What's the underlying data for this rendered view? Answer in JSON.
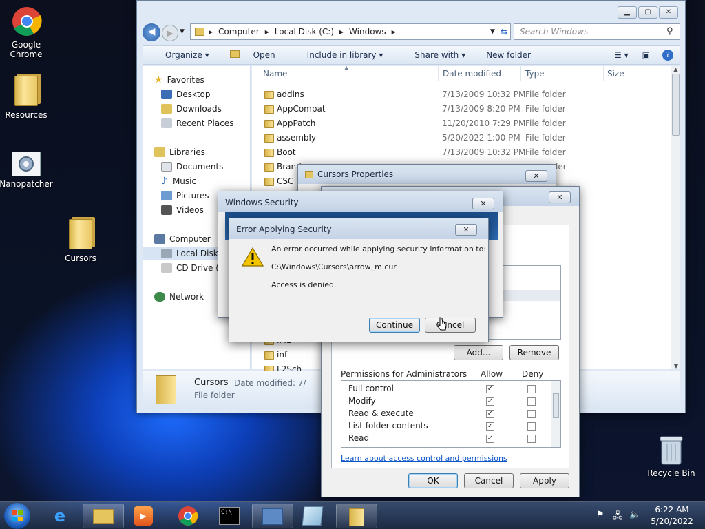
{
  "desktop": {
    "icons": [
      {
        "label": "Google Chrome"
      },
      {
        "label": "Resources"
      },
      {
        "label": "Nanopatcher"
      },
      {
        "label": "Cursors"
      },
      {
        "label": "Recycle Bin"
      }
    ]
  },
  "explorer": {
    "breadcrumb": [
      "Computer",
      "Local Disk (C:)",
      "Windows"
    ],
    "search_placeholder": "Search Windows",
    "toolbar": {
      "organize": "Organize",
      "open": "Open",
      "include": "Include in library",
      "share": "Share with",
      "new_folder": "New folder"
    },
    "nav": {
      "favorites": "Favorites",
      "desktop": "Desktop",
      "downloads": "Downloads",
      "recent": "Recent Places",
      "libraries": "Libraries",
      "documents": "Documents",
      "music": "Music",
      "pictures": "Pictures",
      "videos": "Videos",
      "computer": "Computer",
      "local_disk": "Local Disk (",
      "cd_drive": "CD Drive (D",
      "network": "Network"
    },
    "columns": {
      "name": "Name",
      "date": "Date modified",
      "type": "Type",
      "size": "Size"
    },
    "rows": [
      {
        "name": "addins",
        "date": "7/13/2009 10:32 PM",
        "type": "File folder"
      },
      {
        "name": "AppCompat",
        "date": "7/13/2009 8:20 PM",
        "type": "File folder"
      },
      {
        "name": "AppPatch",
        "date": "11/20/2010 7:29 PM",
        "type": "File folder"
      },
      {
        "name": "assembly",
        "date": "5/20/2022 1:00 PM",
        "type": "File folder"
      },
      {
        "name": "Boot",
        "date": "7/13/2009 10:32 PM",
        "type": "File folder"
      },
      {
        "name": "Brand",
        "date": "",
        "type": "ler"
      },
      {
        "name": "CSC",
        "date": "",
        "type": ""
      }
    ],
    "rows_lower": [
      {
        "name": "IME"
      },
      {
        "name": "inf"
      },
      {
        "name": "L2Sch"
      }
    ],
    "details": {
      "name": "Cursors",
      "date_label": "Date modified: 7/",
      "type": "File folder"
    }
  },
  "cursors_props": {
    "title": "Cursors Properties"
  },
  "security_tab": {
    "add": "Add...",
    "remove": "Remove",
    "perm_header": "Permissions for Administrators",
    "allow": "Allow",
    "deny": "Deny",
    "perms": [
      "Full control",
      "Modify",
      "Read & execute",
      "List folder contents",
      "Read"
    ],
    "link": "Learn about access control and permissions",
    "ok": "OK",
    "cancel": "Cancel",
    "apply": "Apply"
  },
  "windows_security": {
    "title": "Windows Security"
  },
  "error": {
    "title": "Error Applying Security",
    "line1": "An error occurred while applying security information to:",
    "path": "C:\\Windows\\Cursors\\arrow_m.cur",
    "line3": "Access is denied.",
    "continue": "Continue",
    "cancel": "Cancel"
  },
  "tray": {
    "time": "6:22 AM",
    "date": "5/20/2022"
  }
}
